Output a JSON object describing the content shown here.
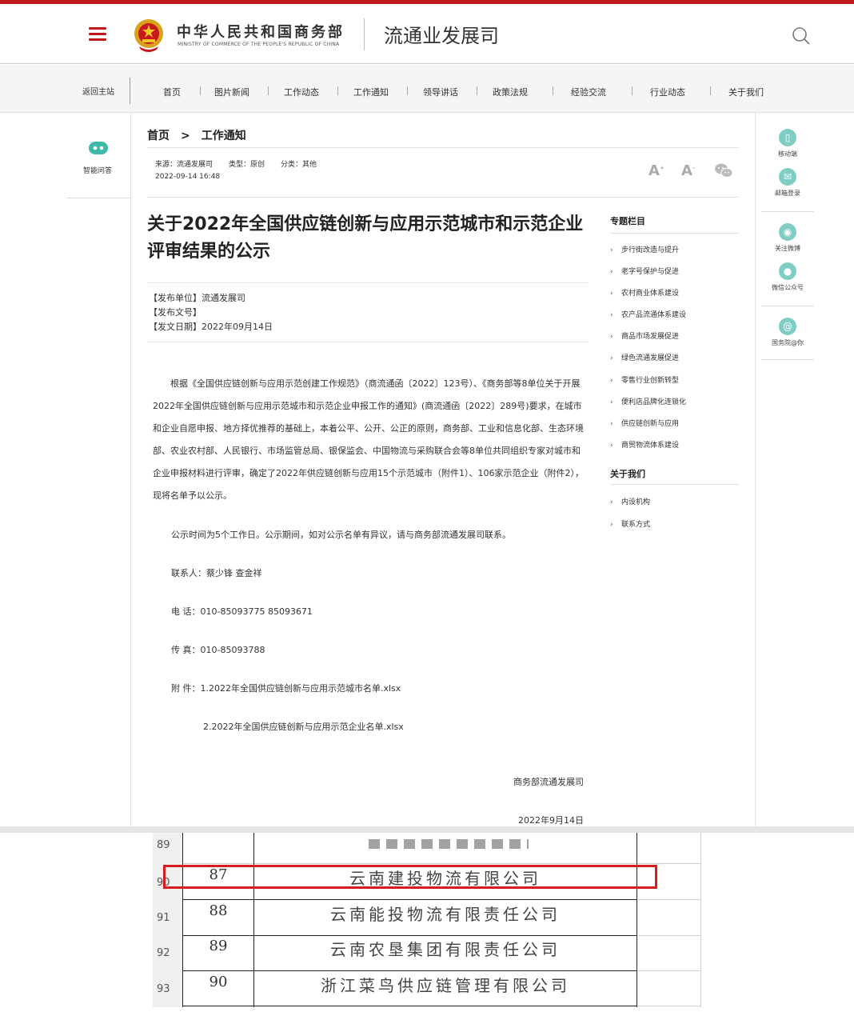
{
  "header": {
    "org_cn": "中华人民共和国商务部",
    "org_en": "MINISTRY OF COMMERCE OF THE PEOPLE'S REPUBLIC OF CHINA",
    "dept_name": "流通业发展司"
  },
  "nav": {
    "home": "返回主站",
    "items": [
      "首页",
      "图片新闻",
      "工作动态",
      "工作通知",
      "领导讲话",
      "政策法规",
      "经验交流",
      "行业动态",
      "关于我们"
    ]
  },
  "left_panel": {
    "smart_qa": "智能问答"
  },
  "right_panel": {
    "mobile": "移动端",
    "mail": "邮箱登录",
    "weibo": "关注微博",
    "wechat": "微信公众号",
    "gov": "国务院@你"
  },
  "breadcrumb": {
    "home": "首页",
    "sep": ">",
    "current": "工作通知"
  },
  "meta": {
    "source": "来源：流通发展司",
    "type": "类型：原创",
    "category": "分类：其他",
    "datetime": "2022-09-14 16:48",
    "font_larger": "A",
    "font_smaller": "A"
  },
  "article": {
    "title": "关于2022年全国供应链创新与应用示范城市和示范企业评审结果的公示",
    "publisher": "【发布单位】流通发展司",
    "doc_no": "【发布文号】",
    "date": "【发文日期】2022年09月14日",
    "body": "根据《全国供应链创新与应用示范创建工作规范》（商流通函〔2022〕123号）、《商务部等8单位关于开展2022年全国供应链创新与应用示范城市和示范企业申报工作的通知》(商流通函〔2022〕289号)要求，在城市和企业自愿申报、地方择优推荐的基础上，本着公平、公开、公正的原则，商务部、工业和信息化部、生态环境部、农业农村部、人民银行、市场监管总局、银保监会、中国物流与采购联合会等8单位共同组织专家对城市和企业申报材料进行评审，确定了2022年供应链创新与应用15个示范城市（附件1）、106家示范企业（附件2），现将名单予以公示。",
    "notice": "公示时间为5个工作日。公示期间，如对公示名单有异议，请与商务部流通发展司联系。",
    "contact": "联系人：蔡少锋 查金祥",
    "phone": "电 话：010-85093775 85093671",
    "fax": "传 真：010-85093788",
    "attach_label": "附 件：",
    "attach1": "1.2022年全国供应链创新与应用示范城市名单.xlsx",
    "attach2": "2.2022年全国供应链创新与应用示范企业名单.xlsx",
    "signature": "商务部流通发展司",
    "sign_date": "2022年9月14日"
  },
  "sidebar": {
    "topics_title": "专题栏目",
    "topics": [
      "步行街改造与提升",
      "老字号保护与促进",
      "农村商业体系建设",
      "农产品流通体系建设",
      "商品市场发展促进",
      "绿色流通发展促进",
      "零售行业创新转型",
      "便利店品牌化连锁化",
      "供应链创新与应用",
      "商贸物流体系建设"
    ],
    "about_title": "关于我们",
    "about": [
      "内设机构",
      "联系方式"
    ]
  },
  "sheet": {
    "rows": [
      {
        "row": "89",
        "num": "",
        "name": ""
      },
      {
        "row": "90",
        "num": "87",
        "name": "云南建投物流有限公司"
      },
      {
        "row": "91",
        "num": "88",
        "name": "云南能投物流有限责任公司"
      },
      {
        "row": "92",
        "num": "89",
        "name": "云南农垦集团有限责任公司"
      },
      {
        "row": "93",
        "num": "90",
        "name": "浙江菜鸟供应链管理有限公司"
      }
    ]
  },
  "colors": {
    "brand_red": "#bf1a1a",
    "highlight_red": "#d61d1d",
    "teal": "#7fcdc4"
  }
}
